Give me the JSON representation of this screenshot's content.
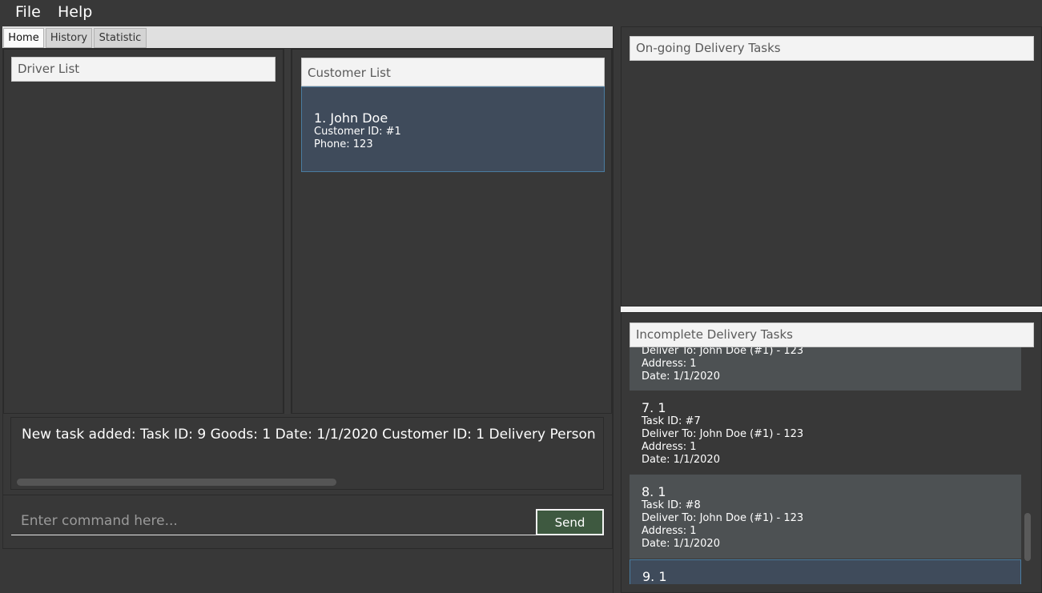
{
  "menu": {
    "file": "File",
    "help": "Help"
  },
  "tabs": {
    "home": "Home",
    "history": "History",
    "statistic": "Statistic"
  },
  "driver_list": {
    "title": "Driver List"
  },
  "customer_list": {
    "title": "Customer List",
    "items": [
      {
        "title": "1.  John Doe",
        "customer_id": "Customer ID: #1",
        "phone": "Phone: 123"
      }
    ]
  },
  "result": {
    "text": "New task added:  Task ID: 9 Goods: 1 Date: 1/1/2020 Customer ID: 1 Delivery Person"
  },
  "command": {
    "placeholder": "Enter command here...",
    "send_label": "Send"
  },
  "ongoing": {
    "title": "On-going Delivery Tasks"
  },
  "incomplete": {
    "title": "Incomplete Delivery Tasks",
    "partial": {
      "deliver_to": "Deliver To: John Doe (#1) - 123",
      "address": "Address: 1",
      "date": "Date: 1/1/2020"
    },
    "items": [
      {
        "title": "7.  1",
        "task_id": "Task ID: #7",
        "deliver_to": "Deliver To: John Doe (#1) - 123",
        "address": "Address: 1",
        "date": "Date: 1/1/2020"
      },
      {
        "title": "8.  1",
        "task_id": "Task ID: #8",
        "deliver_to": "Deliver To: John Doe (#1) - 123",
        "address": "Address: 1",
        "date": "Date: 1/1/2020"
      },
      {
        "title": "9.  1"
      }
    ]
  },
  "colors": {
    "background": "#383838",
    "header_bg": "#f3f3f3",
    "selected_card": "#3f4b5b",
    "send_button": "#3e5940"
  }
}
